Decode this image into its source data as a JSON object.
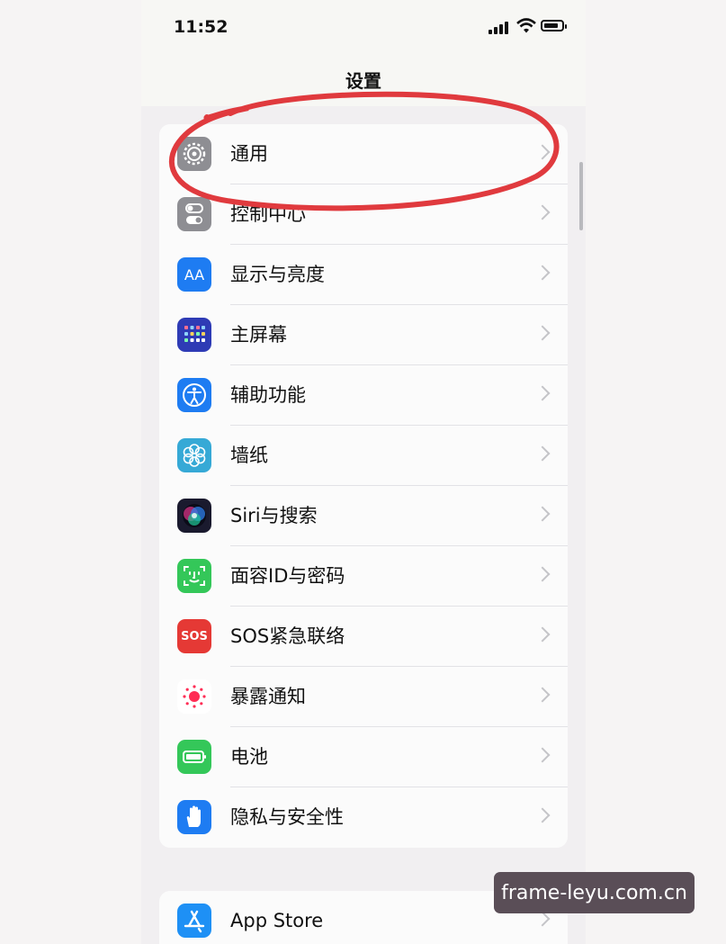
{
  "status_bar": {
    "time": "11:52"
  },
  "nav": {
    "title": "设置"
  },
  "settings_group_1": [
    {
      "label": "通用",
      "icon": "gear-icon",
      "icon_bg": "#8e8e93"
    },
    {
      "label": "控制中心",
      "icon": "toggles-icon",
      "icon_bg": "#8e8e93"
    },
    {
      "label": "显示与亮度",
      "icon": "display-aa-icon",
      "icon_bg": "#1e7cf2",
      "icon_text": "AA"
    },
    {
      "label": "主屏幕",
      "icon": "home-grid-icon",
      "icon_bg": "#2e3bb5"
    },
    {
      "label": "辅助功能",
      "icon": "accessibility-icon",
      "icon_bg": "#1e7cf2"
    },
    {
      "label": "墙纸",
      "icon": "flower-icon",
      "icon_bg": "#36a9d6"
    },
    {
      "label": "Siri与搜索",
      "icon": "siri-icon",
      "icon_bg": "#1a1a2e"
    },
    {
      "label": "面容ID与密码",
      "icon": "face-id-icon",
      "icon_bg": "#34c759"
    },
    {
      "label": "SOS紧急联络",
      "icon": "sos-icon",
      "icon_bg": "#e53935",
      "icon_text": "SOS"
    },
    {
      "label": "暴露通知",
      "icon": "exposure-icon",
      "icon_bg": "#ffffff"
    },
    {
      "label": "电池",
      "icon": "battery-icon",
      "icon_bg": "#34c759"
    },
    {
      "label": "隐私与安全性",
      "icon": "hand-icon",
      "icon_bg": "#1e7cf2"
    }
  ],
  "settings_group_2": [
    {
      "label": "App Store",
      "icon": "app-store-icon",
      "icon_bg": "#1e90f5"
    }
  ],
  "annotation": {
    "color": "#e03a3e"
  },
  "watermark": {
    "text": "frame-leyu.com.cn"
  }
}
